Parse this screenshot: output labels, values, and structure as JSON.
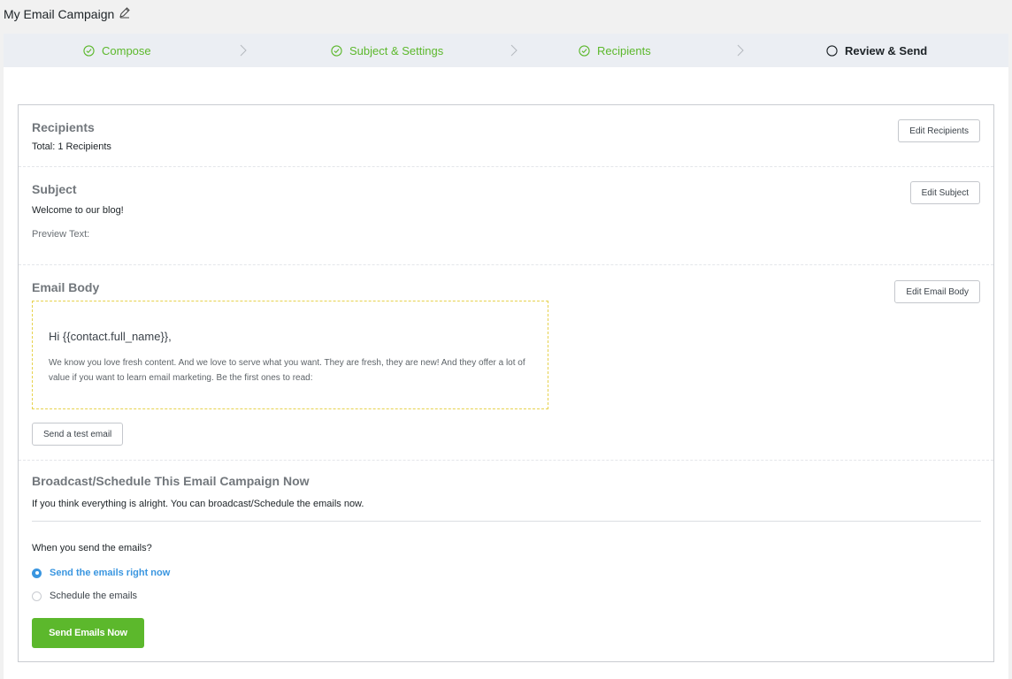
{
  "campaign": {
    "title": "My Email Campaign",
    "edit_icon": "pencil-icon"
  },
  "steps": [
    {
      "label": "Compose",
      "state": "done"
    },
    {
      "label": "Subject & Settings",
      "state": "done"
    },
    {
      "label": "Recipients",
      "state": "done"
    },
    {
      "label": "Review & Send",
      "state": "current"
    }
  ],
  "recipients": {
    "title": "Recipients",
    "total": "Total: 1 Recipients",
    "edit_label": "Edit Recipients"
  },
  "subject": {
    "title": "Subject",
    "value": "Welcome to our blog!",
    "preview_label": "Preview Text:",
    "edit_label": "Edit Subject"
  },
  "email_body": {
    "title": "Email Body",
    "edit_label": "Edit Email Body",
    "greeting": "Hi {{contact.full_name}},",
    "text": "We know you love fresh content. And we love to serve what you want. They are fresh, they are new! And they offer a lot of value if you want to learn email marketing. Be the first ones to read:",
    "test_label": "Send a test email"
  },
  "broadcast": {
    "title": "Broadcast/Schedule This Email Campaign Now",
    "description": "If you think everything is alright. You can broadcast/Schedule the emails now.",
    "question": "When you send the emails?",
    "options": [
      {
        "label": "Send the emails right now",
        "selected": true
      },
      {
        "label": "Schedule the emails",
        "selected": false
      }
    ],
    "send_label": "Send Emails Now"
  },
  "colors": {
    "accent_green": "#5cb82c",
    "accent_blue": "#3a96e0"
  }
}
